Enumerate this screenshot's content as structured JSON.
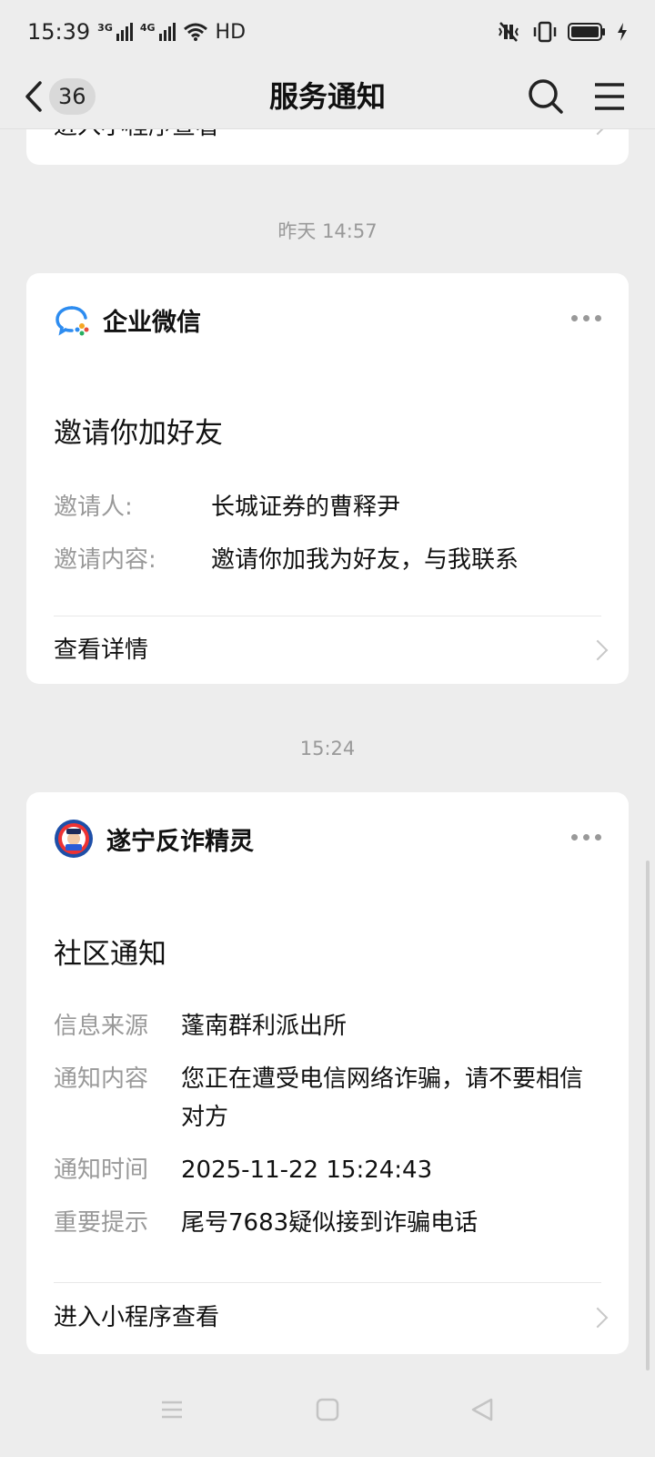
{
  "status_bar": {
    "time": "15:39",
    "net1": "3G",
    "net2": "4G",
    "hd": "HD"
  },
  "nav": {
    "badge_count": "36",
    "title": "服务通知"
  },
  "top_card": {
    "link": "进入小程序查看"
  },
  "message1": {
    "timestamp": "昨天 14:57",
    "sender": "企业微信",
    "title": "邀请你加好友",
    "fields": [
      {
        "key": "邀请人:",
        "value": "长城证券的曹释尹"
      },
      {
        "key": "邀请内容:",
        "value": "邀请你加我为好友，与我联系"
      }
    ],
    "footer": "查看详情"
  },
  "message2": {
    "timestamp": "15:24",
    "sender": "遂宁反诈精灵",
    "title": "社区通知",
    "fields": [
      {
        "key": "信息来源",
        "value": "蓬南群利派出所"
      },
      {
        "key": "通知内容",
        "value": "您正在遭受电信网络诈骗，请不要相信对方"
      },
      {
        "key": "通知时间",
        "value": "2025-11-22 15:24:43"
      },
      {
        "key": "重要提示",
        "value": "尾号7683疑似接到诈骗电话"
      }
    ],
    "footer": "进入小程序查看"
  },
  "colors": {
    "background": "#ededed",
    "card": "#ffffff",
    "muted_text": "#999999"
  }
}
